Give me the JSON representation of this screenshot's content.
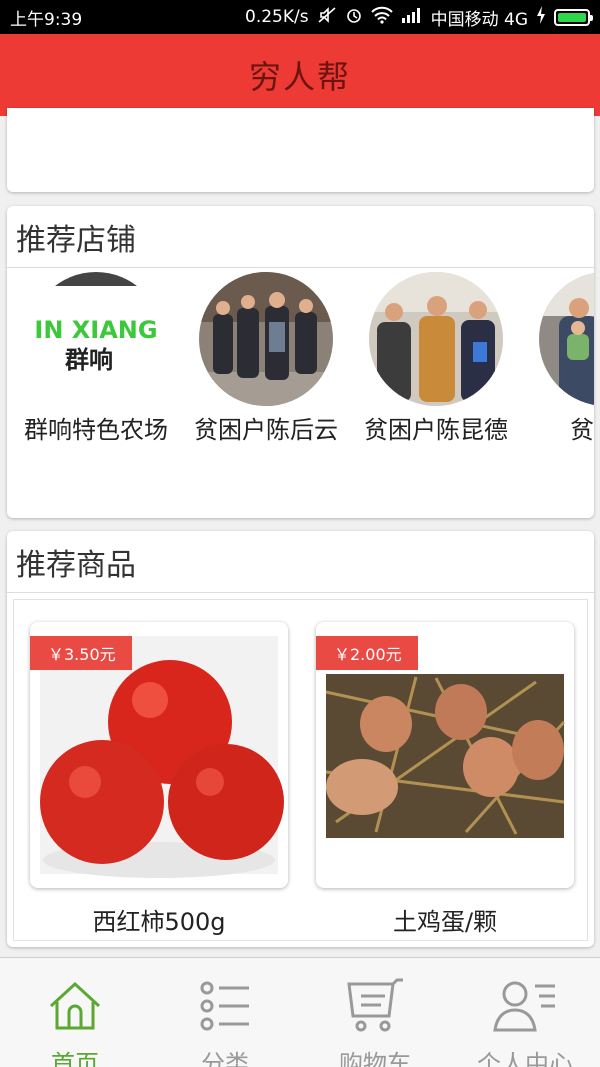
{
  "status_bar": {
    "time": "上午9:39",
    "net_speed": "0.25K/s",
    "carrier": "中国移动 4G",
    "battery_level": 1.0
  },
  "header": {
    "title": "穷人帮"
  },
  "shops_section": {
    "title": "推荐店铺",
    "shops": [
      {
        "name": "群响特色农场",
        "logo_text_top": "IN XIANG",
        "logo_text_bottom": "群响"
      },
      {
        "name": "贫困户陈后云"
      },
      {
        "name": "贫困户陈昆德"
      },
      {
        "name": "贫困户"
      }
    ]
  },
  "goods_section": {
    "title": "推荐商品",
    "products": [
      {
        "name": "西红柿500g",
        "price": "￥3.50元"
      },
      {
        "name": "土鸡蛋/颗",
        "price": "￥2.00元"
      }
    ]
  },
  "tabbar": {
    "tabs": [
      {
        "label": "首页",
        "icon": "home-icon",
        "active": true
      },
      {
        "label": "分类",
        "icon": "list-icon",
        "active": false
      },
      {
        "label": "购物车",
        "icon": "cart-icon",
        "active": false
      },
      {
        "label": "个人中心",
        "icon": "person-icon",
        "active": false
      }
    ]
  },
  "colors": {
    "header_bg": "#ee3a34",
    "header_text": "#6b1410",
    "price_badge": "#e94a44",
    "tab_active": "#5aa832",
    "tab_inactive": "#999999"
  }
}
